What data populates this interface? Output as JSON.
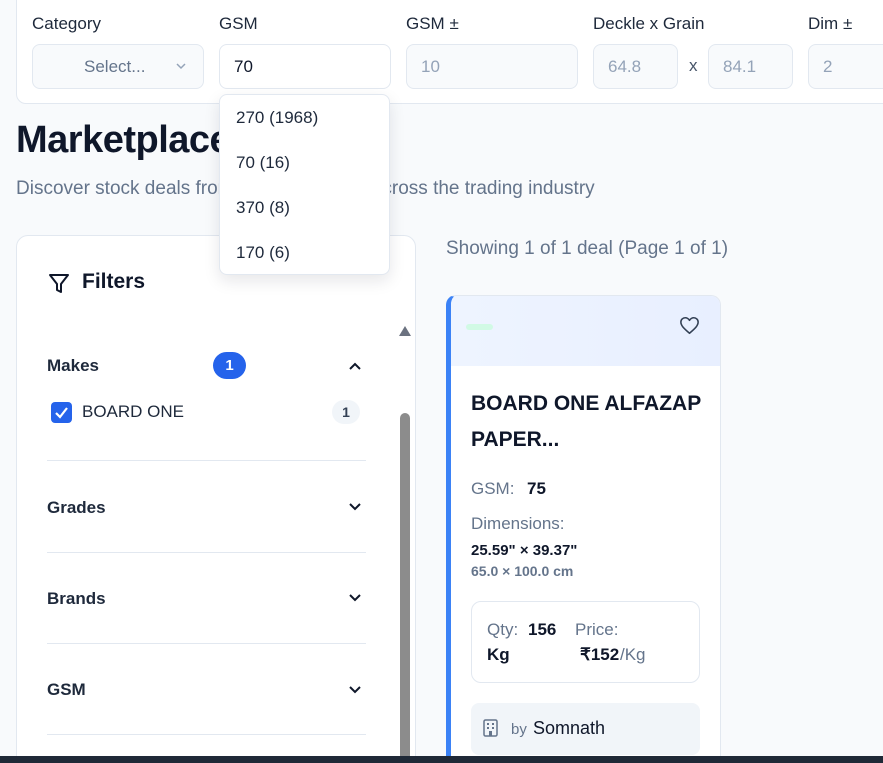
{
  "search": {
    "category_label": "Category",
    "category_value": "Select...",
    "gsm_label": "GSM",
    "gsm_value": "70",
    "gsm_tol_label": "GSM ±",
    "gsm_tol_value": "10",
    "deckle_label": "Deckle x Grain",
    "deckle_value": "64.8",
    "grain_value": "84.1",
    "deckle_sep": "x",
    "dim_tol_label": "Dim ±",
    "dim_tol_value": "2"
  },
  "gsm_dropdown": {
    "options": [
      "270 (1968)",
      "70 (16)",
      "370 (8)",
      "170 (6)"
    ]
  },
  "page": {
    "title": "Marketplace",
    "subtitle": "Discover stock deals from other members across the trading industry"
  },
  "filters": {
    "heading": "Filters",
    "sections": [
      {
        "title": "Makes",
        "count": "1",
        "expanded": true
      },
      {
        "title": "Grades",
        "expanded": false
      },
      {
        "title": "Brands",
        "expanded": false
      },
      {
        "title": "GSM",
        "expanded": false
      }
    ],
    "makes_items": [
      {
        "label": "BOARD ONE",
        "count": "1",
        "checked": true
      }
    ]
  },
  "results": {
    "showing_text": "Showing 1 of 1 deal (Page 1 of 1)"
  },
  "deal": {
    "title": "BOARD ONE ALFAZAP PAPER...",
    "gsm_label": "GSM:",
    "gsm_value": "75",
    "dimensions_label": "Dimensions:",
    "dim_inches": "25.59\" × 39.37\"",
    "dim_cm": "65.0 × 100.0 cm",
    "qty_label": "Qty:",
    "qty_value": "156",
    "qty_unit": "Kg",
    "price_label": "Price:",
    "price_value": "₹152",
    "price_unit": "/Kg",
    "seller_prefix": "by",
    "seller_name": "Somnath"
  },
  "colors": {
    "accent": "#2563eb",
    "card_border_accent": "#3b82f6"
  }
}
